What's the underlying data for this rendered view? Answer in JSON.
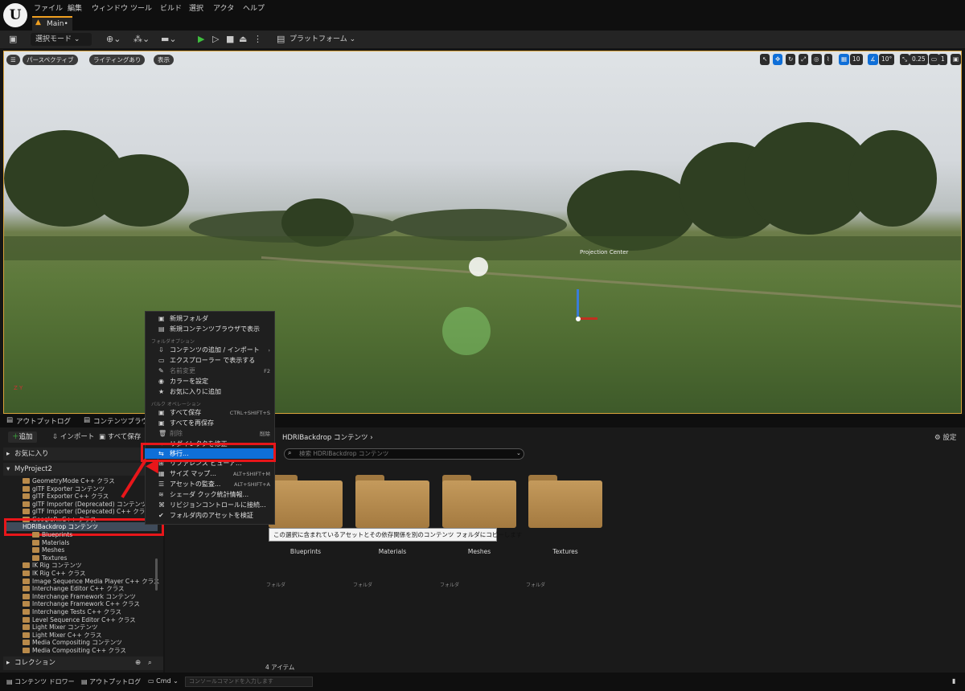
{
  "menubar": {
    "logo": "U",
    "items": [
      "ファイル",
      "編集",
      "ウィンドウ",
      "ツール",
      "ビルド",
      "選択",
      "アクタ",
      "ヘルプ"
    ]
  },
  "tab": {
    "label": "Main•"
  },
  "toolbar": {
    "mode_label": "選択モード ⌄",
    "platform_label": "プラットフォーム ⌄"
  },
  "viewport": {
    "perspective_label": "パースペクティブ",
    "lighting_label": "ライティングあり",
    "show_label": "表示",
    "grid_value": "10",
    "angle_value": "10°",
    "scale_value": "0.25",
    "camera_value": "1",
    "projection_label": "Projection Center",
    "axis_labels": "Z Y"
  },
  "bottom_tabs": {
    "output_log": "アウトプットログ",
    "content_browser": "コンテンツブラウ..."
  },
  "content_browser": {
    "add_label": "追加",
    "import_label": "インポート",
    "save_all_label": "すべて保存",
    "favorites_label": "お気に入り",
    "project_label": "MyProject2",
    "collection_label": "コレクション",
    "breadcrumb": "HDRIBackdrop コンテンツ",
    "settings_label": "設定",
    "search_placeholder": "検索 HDRIBackdrop コンテンツ",
    "item_count": "4 アイテム",
    "folder_type": "フォルダ",
    "selected_folder": "HDRIBackdrop コンテンツ",
    "tree_items": [
      "GeometryMode C++ クラス",
      "glTF Exporter コンテンツ",
      "glTF Exporter C++ クラス",
      "glTF Importer (Deprecated) コンテンツ",
      "glTF Importer (Deprecated) C++ クラス",
      "GoogleP...C++ クラス"
    ],
    "sub_items": [
      "Blueprints",
      "Materials",
      "Meshes",
      "Textures"
    ],
    "tree_items_after": [
      "IK Rig コンテンツ",
      "IK Rig C++ クラス",
      "Image Sequence Media Player C++ クラス",
      "Interchange Editor C++ クラス",
      "Interchange Framework コンテンツ",
      "Interchange Framework C++ クラス",
      "Interchange Tests C++ クラス",
      "Level Sequence Editor C++ クラス",
      "Light Mixer コンテンツ",
      "Light Mixer C++ クラス",
      "Media Compositing コンテンツ",
      "Media Compositing C++ クラス"
    ],
    "folders": [
      "Blueprints",
      "Materials",
      "Meshes",
      "Textures"
    ]
  },
  "context_menu": {
    "new_folder": "新規フォルダ",
    "new_browser": "新規コンテンツブラウザで表示",
    "section_folder": "フォルダオプション",
    "add_import": "コンテンツの追加 / インポート",
    "show_explorer": "エクスプローラー で表示する",
    "rename": "名前変更",
    "rename_sc": "F2",
    "set_color": "カラーを設定",
    "add_favorite": "お気に入りに追加",
    "section_bulk": "バルク オペレーション",
    "save_all": "すべて保存",
    "save_all_sc": "CTRL+SHIFT+S",
    "resave_all": "すべてを再保存",
    "delete": "削除",
    "delete_sc": "削除",
    "redirector": "リダイレクタを修正",
    "migrate": "移行...",
    "ref_viewer": "リファレンス ビューア...",
    "size_map": "サイズ マップ...",
    "size_map_sc": "ALT+SHIFT+M",
    "audit": "アセットの監査...",
    "audit_sc": "ALT+SHIFT+A",
    "shader_stats": "シェーダ クック統計情報...",
    "source_control": "リビジョンコントロールに接続...",
    "validate": "フォルダ内のアセットを検証",
    "tooltip": "この選択に含まれているアセットとその依存関係を別のコンテンツ フォルダにコピーします"
  },
  "statusbar": {
    "content_drawer": "コンテンツ ドロワー",
    "output_log": "アウトプットログ",
    "cmd": "Cmd ⌄",
    "console_placeholder": "コンソールコマンドを入力します"
  },
  "colors": {
    "accent": "#0f6fd8",
    "annotation_red": "#e8161a",
    "folder": "#b98a4a",
    "viewport_border": "#d9a23a"
  }
}
